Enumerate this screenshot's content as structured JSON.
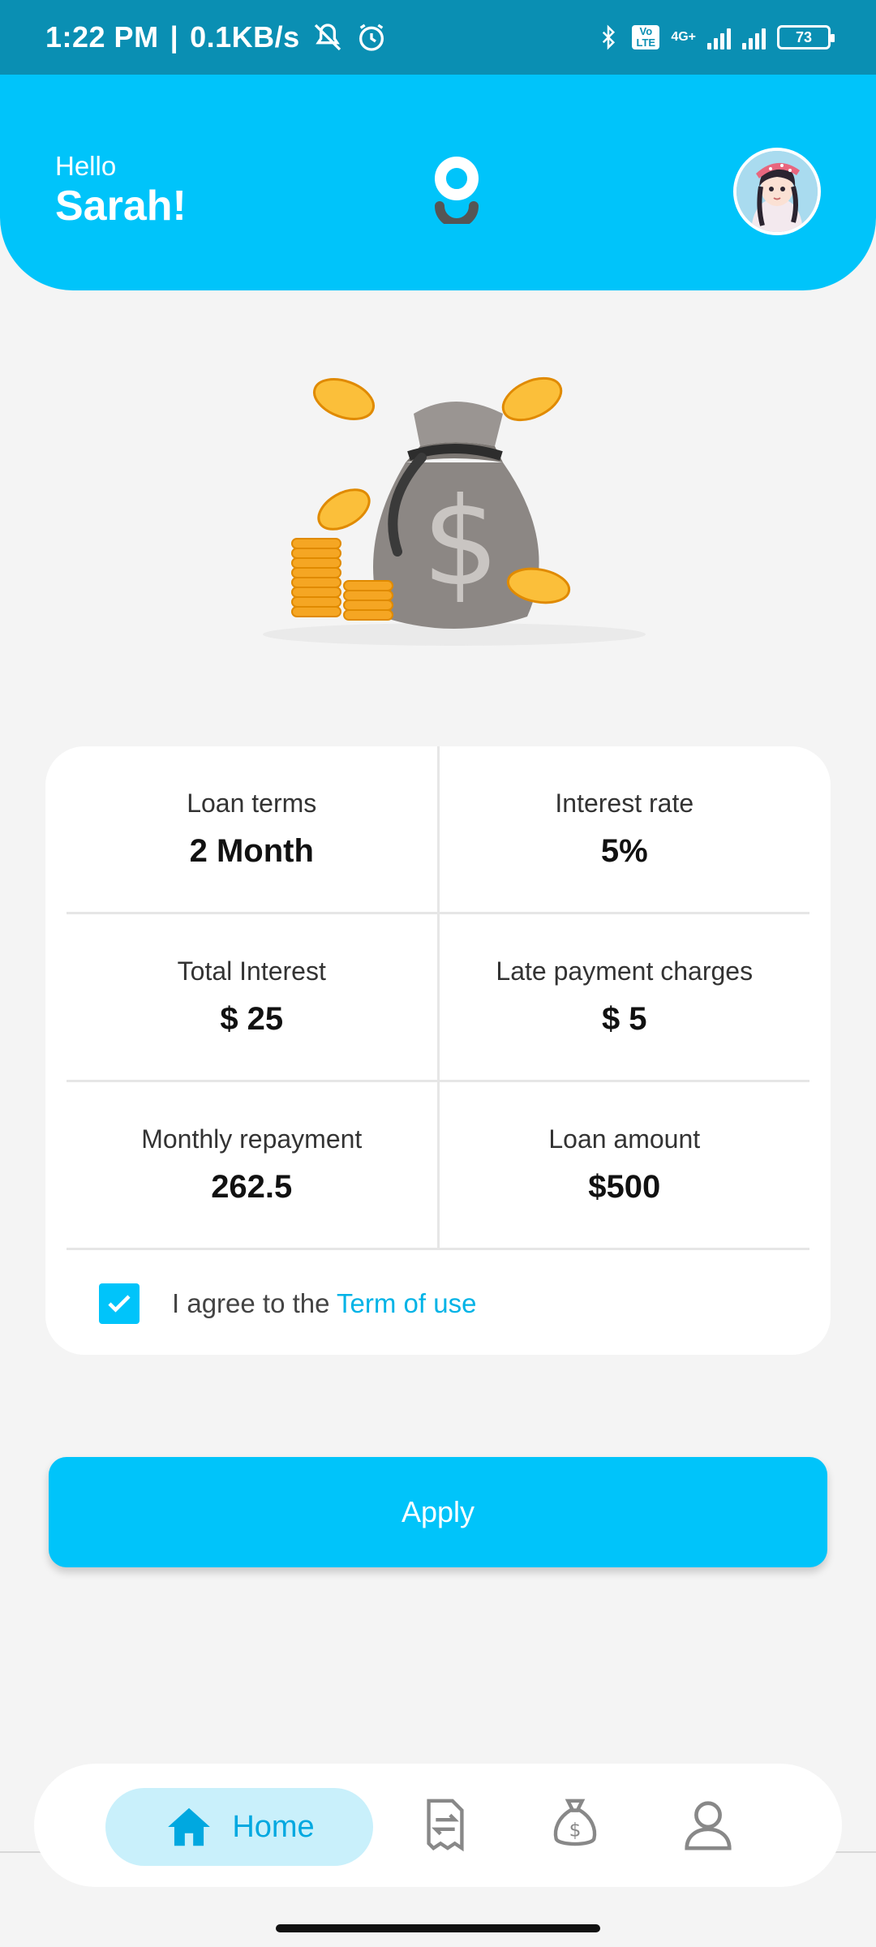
{
  "status_bar": {
    "time": "1:22 PM",
    "speed": "0.1KB/s",
    "network_label": "4G+",
    "volte_label": "Vo LTE",
    "battery": "73"
  },
  "header": {
    "greeting": "Hello",
    "user_name": "Sarah!"
  },
  "loan_details": {
    "rows": [
      [
        {
          "label": "Loan terms",
          "value": "2 Month"
        },
        {
          "label": "Interest rate",
          "value": "5%"
        }
      ],
      [
        {
          "label": "Total Interest",
          "value": "$ 25"
        },
        {
          "label": "Late payment charges",
          "value": "$ 5"
        }
      ],
      [
        {
          "label": "Monthly repayment",
          "value": "262.5"
        },
        {
          "label": "Loan amount",
          "value": "$500"
        }
      ]
    ]
  },
  "agreement": {
    "checked": true,
    "text": "I agree to the ",
    "link": "Term of use"
  },
  "apply_label": "Apply",
  "bottom_nav": {
    "items": [
      {
        "label": "Home",
        "icon": "home-icon",
        "active": true
      },
      {
        "label": "",
        "icon": "document-icon",
        "active": false
      },
      {
        "label": "",
        "icon": "money-bag-icon",
        "active": false
      },
      {
        "label": "",
        "icon": "user-icon",
        "active": false
      }
    ]
  },
  "colors": {
    "accent": "#00c4fa",
    "status_bar": "#0a8fb3",
    "background": "#f4f4f4"
  }
}
